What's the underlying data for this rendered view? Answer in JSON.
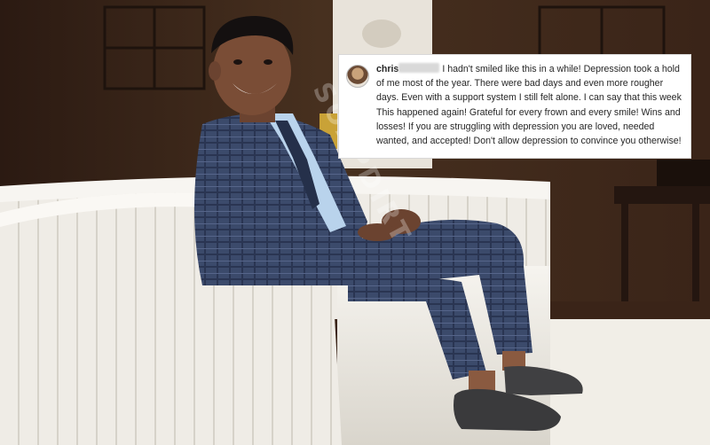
{
  "scene": {
    "description_icon": "photo-scene",
    "colors": {
      "wall": "#3a2418",
      "sofa": "#eeebe4",
      "suit": "#3b4a6b",
      "rug": "#f1eee7"
    }
  },
  "caption": {
    "username": "chris",
    "text": "I hadn't smiled like this in a while! Depression took a hold of me most of the year. There were bad days and even more rougher days. Even with a support system I still felt alone. I can say that this week This happened again! Grateful for every frown and every smile! Wins and losses! If you are struggling with depression you are loved, needed wanted, and accepted! Don't allow depression to convince you otherwise!"
  },
  "watermark": "SOAPDIRT"
}
